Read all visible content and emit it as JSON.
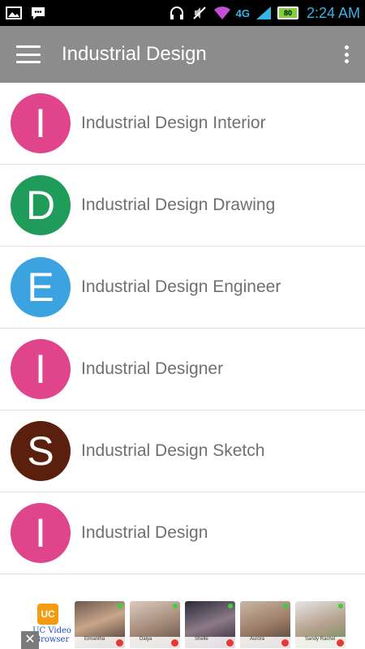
{
  "status_bar": {
    "network": "4G",
    "battery": "80",
    "time": "2:24 AM"
  },
  "app_bar": {
    "title": "Industrial Design"
  },
  "list": {
    "items": [
      {
        "letter": "I",
        "label": "Industrial Design Interior",
        "color": "#e0448a"
      },
      {
        "letter": "D",
        "label": "Industrial Design Drawing",
        "color": "#1f9b5a"
      },
      {
        "letter": "E",
        "label": "Industrial Design Engineer",
        "color": "#3ba3e0"
      },
      {
        "letter": "I",
        "label": "Industrial Designer",
        "color": "#e0448a"
      },
      {
        "letter": "S",
        "label": "Industrial Design Sketch",
        "color": "#5b1f0d"
      },
      {
        "letter": "I",
        "label": "Industrial Design",
        "color": "#e0448a"
      }
    ]
  },
  "ad": {
    "close": "✕",
    "brand_logo": "UC",
    "brand_text_line1": "UC Video",
    "brand_text_line2": "Browser",
    "thumbs": [
      {
        "name": "Elmantha"
      },
      {
        "name": "Dalya"
      },
      {
        "name": "Shelle"
      },
      {
        "name": "Aurora"
      },
      {
        "name": "Sandy Rachel"
      }
    ]
  }
}
